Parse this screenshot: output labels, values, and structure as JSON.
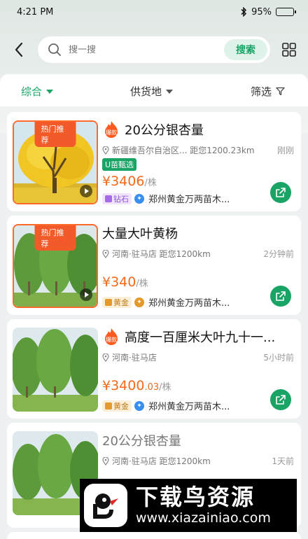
{
  "status_bar": {
    "time": "4:21 PM",
    "battery": "95%",
    "battery_level": 0.95
  },
  "search": {
    "placeholder": "搜一搜",
    "button": "搜索"
  },
  "filters": [
    {
      "label": "综合"
    },
    {
      "label": "供货地"
    },
    {
      "label": "筛选"
    }
  ],
  "hot_tag": "热门推荐",
  "fire_tag": "爆款",
  "items": [
    {
      "title": "20公分银杏量",
      "location": "新疆维吾尔自治区... 距您1200.23km",
      "time": "刚刚",
      "badge": "U苗甄选",
      "price_int": "¥3406",
      "price_dec": "",
      "unit": "/株",
      "level": "钻石",
      "company": "郑州黄金万两苗木...",
      "hot": true,
      "fire": true
    },
    {
      "title": "大量大叶黄杨",
      "location": "河南·驻马店 距您1200km",
      "time": "2分钟前",
      "badge": "",
      "price_int": "¥340",
      "price_dec": "",
      "unit": "/株",
      "level": "黄金",
      "company": "郑州黄金万两苗木...",
      "hot": true,
      "fire": false
    },
    {
      "title": "高度一百厘米大叶九十一...",
      "location": "河南·驻马店",
      "time": "5小时前",
      "badge": "",
      "price_int": "¥3400",
      "price_dec": ".03",
      "unit": "/株",
      "level": "黄金",
      "company": "郑州黄金万两苗木...",
      "hot": false,
      "fire": true
    },
    {
      "title": "20公分银杏量",
      "location": "河南·驻马店 距您1200km",
      "time": "1天前"
    }
  ],
  "watermark": {
    "title": "下载鸟资源",
    "url": "www.xiazainiao.com"
  },
  "colors": {
    "accent": "#19a465",
    "price": "#f26a1b",
    "hot": "#f35a2a"
  }
}
